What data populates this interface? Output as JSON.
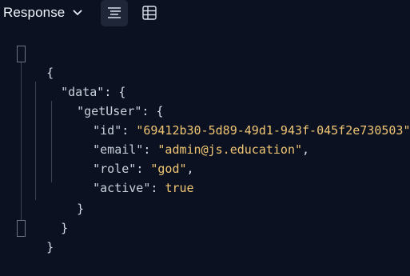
{
  "toolbar": {
    "title": "Response",
    "buttons": [
      {
        "name": "formatted-view",
        "icon": "align-lines-icon",
        "active": true
      },
      {
        "name": "table-view",
        "icon": "table-grid-icon",
        "active": false
      }
    ]
  },
  "json": {
    "open_root": "{",
    "data_key": "\"data\"",
    "getuser_key": "\"getUser\"",
    "id_key": "\"id\"",
    "id_value": "\"69412b30-5d89-49d1-943f-045f2e730503\"",
    "email_key": "\"email\"",
    "email_value": "\"admin@js.education\"",
    "role_key": "\"role\"",
    "role_value": "\"god\"",
    "active_key": "\"active\"",
    "active_value": "true",
    "close_getuser": "}",
    "close_data": "}",
    "close_root": "}"
  },
  "colors": {
    "background": "#0b1120",
    "string": "#f0c674",
    "key": "#c9d1dd",
    "active_button": "#1e2638"
  }
}
